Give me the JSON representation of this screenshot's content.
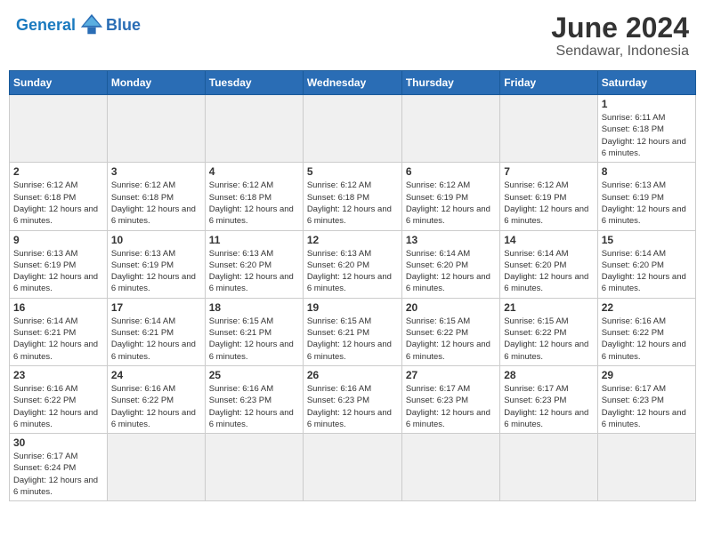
{
  "header": {
    "logo_general": "General",
    "logo_blue": "Blue",
    "month_year": "June 2024",
    "location": "Sendawar, Indonesia"
  },
  "weekdays": [
    "Sunday",
    "Monday",
    "Tuesday",
    "Wednesday",
    "Thursday",
    "Friday",
    "Saturday"
  ],
  "days": {
    "d1": {
      "num": "1",
      "sunrise": "6:11 AM",
      "sunset": "6:18 PM",
      "daylight": "12 hours and 6 minutes."
    },
    "d2": {
      "num": "2",
      "sunrise": "6:12 AM",
      "sunset": "6:18 PM",
      "daylight": "12 hours and 6 minutes."
    },
    "d3": {
      "num": "3",
      "sunrise": "6:12 AM",
      "sunset": "6:18 PM",
      "daylight": "12 hours and 6 minutes."
    },
    "d4": {
      "num": "4",
      "sunrise": "6:12 AM",
      "sunset": "6:18 PM",
      "daylight": "12 hours and 6 minutes."
    },
    "d5": {
      "num": "5",
      "sunrise": "6:12 AM",
      "sunset": "6:18 PM",
      "daylight": "12 hours and 6 minutes."
    },
    "d6": {
      "num": "6",
      "sunrise": "6:12 AM",
      "sunset": "6:19 PM",
      "daylight": "12 hours and 6 minutes."
    },
    "d7": {
      "num": "7",
      "sunrise": "6:12 AM",
      "sunset": "6:19 PM",
      "daylight": "12 hours and 6 minutes."
    },
    "d8": {
      "num": "8",
      "sunrise": "6:13 AM",
      "sunset": "6:19 PM",
      "daylight": "12 hours and 6 minutes."
    },
    "d9": {
      "num": "9",
      "sunrise": "6:13 AM",
      "sunset": "6:19 PM",
      "daylight": "12 hours and 6 minutes."
    },
    "d10": {
      "num": "10",
      "sunrise": "6:13 AM",
      "sunset": "6:19 PM",
      "daylight": "12 hours and 6 minutes."
    },
    "d11": {
      "num": "11",
      "sunrise": "6:13 AM",
      "sunset": "6:20 PM",
      "daylight": "12 hours and 6 minutes."
    },
    "d12": {
      "num": "12",
      "sunrise": "6:13 AM",
      "sunset": "6:20 PM",
      "daylight": "12 hours and 6 minutes."
    },
    "d13": {
      "num": "13",
      "sunrise": "6:14 AM",
      "sunset": "6:20 PM",
      "daylight": "12 hours and 6 minutes."
    },
    "d14": {
      "num": "14",
      "sunrise": "6:14 AM",
      "sunset": "6:20 PM",
      "daylight": "12 hours and 6 minutes."
    },
    "d15": {
      "num": "15",
      "sunrise": "6:14 AM",
      "sunset": "6:20 PM",
      "daylight": "12 hours and 6 minutes."
    },
    "d16": {
      "num": "16",
      "sunrise": "6:14 AM",
      "sunset": "6:21 PM",
      "daylight": "12 hours and 6 minutes."
    },
    "d17": {
      "num": "17",
      "sunrise": "6:14 AM",
      "sunset": "6:21 PM",
      "daylight": "12 hours and 6 minutes."
    },
    "d18": {
      "num": "18",
      "sunrise": "6:15 AM",
      "sunset": "6:21 PM",
      "daylight": "12 hours and 6 minutes."
    },
    "d19": {
      "num": "19",
      "sunrise": "6:15 AM",
      "sunset": "6:21 PM",
      "daylight": "12 hours and 6 minutes."
    },
    "d20": {
      "num": "20",
      "sunrise": "6:15 AM",
      "sunset": "6:22 PM",
      "daylight": "12 hours and 6 minutes."
    },
    "d21": {
      "num": "21",
      "sunrise": "6:15 AM",
      "sunset": "6:22 PM",
      "daylight": "12 hours and 6 minutes."
    },
    "d22": {
      "num": "22",
      "sunrise": "6:16 AM",
      "sunset": "6:22 PM",
      "daylight": "12 hours and 6 minutes."
    },
    "d23": {
      "num": "23",
      "sunrise": "6:16 AM",
      "sunset": "6:22 PM",
      "daylight": "12 hours and 6 minutes."
    },
    "d24": {
      "num": "24",
      "sunrise": "6:16 AM",
      "sunset": "6:22 PM",
      "daylight": "12 hours and 6 minutes."
    },
    "d25": {
      "num": "25",
      "sunrise": "6:16 AM",
      "sunset": "6:23 PM",
      "daylight": "12 hours and 6 minutes."
    },
    "d26": {
      "num": "26",
      "sunrise": "6:16 AM",
      "sunset": "6:23 PM",
      "daylight": "12 hours and 6 minutes."
    },
    "d27": {
      "num": "27",
      "sunrise": "6:17 AM",
      "sunset": "6:23 PM",
      "daylight": "12 hours and 6 minutes."
    },
    "d28": {
      "num": "28",
      "sunrise": "6:17 AM",
      "sunset": "6:23 PM",
      "daylight": "12 hours and 6 minutes."
    },
    "d29": {
      "num": "29",
      "sunrise": "6:17 AM",
      "sunset": "6:23 PM",
      "daylight": "12 hours and 6 minutes."
    },
    "d30": {
      "num": "30",
      "sunrise": "6:17 AM",
      "sunset": "6:24 PM",
      "daylight": "12 hours and 6 minutes."
    }
  },
  "labels": {
    "sunrise": "Sunrise:",
    "sunset": "Sunset:",
    "daylight": "Daylight:"
  }
}
